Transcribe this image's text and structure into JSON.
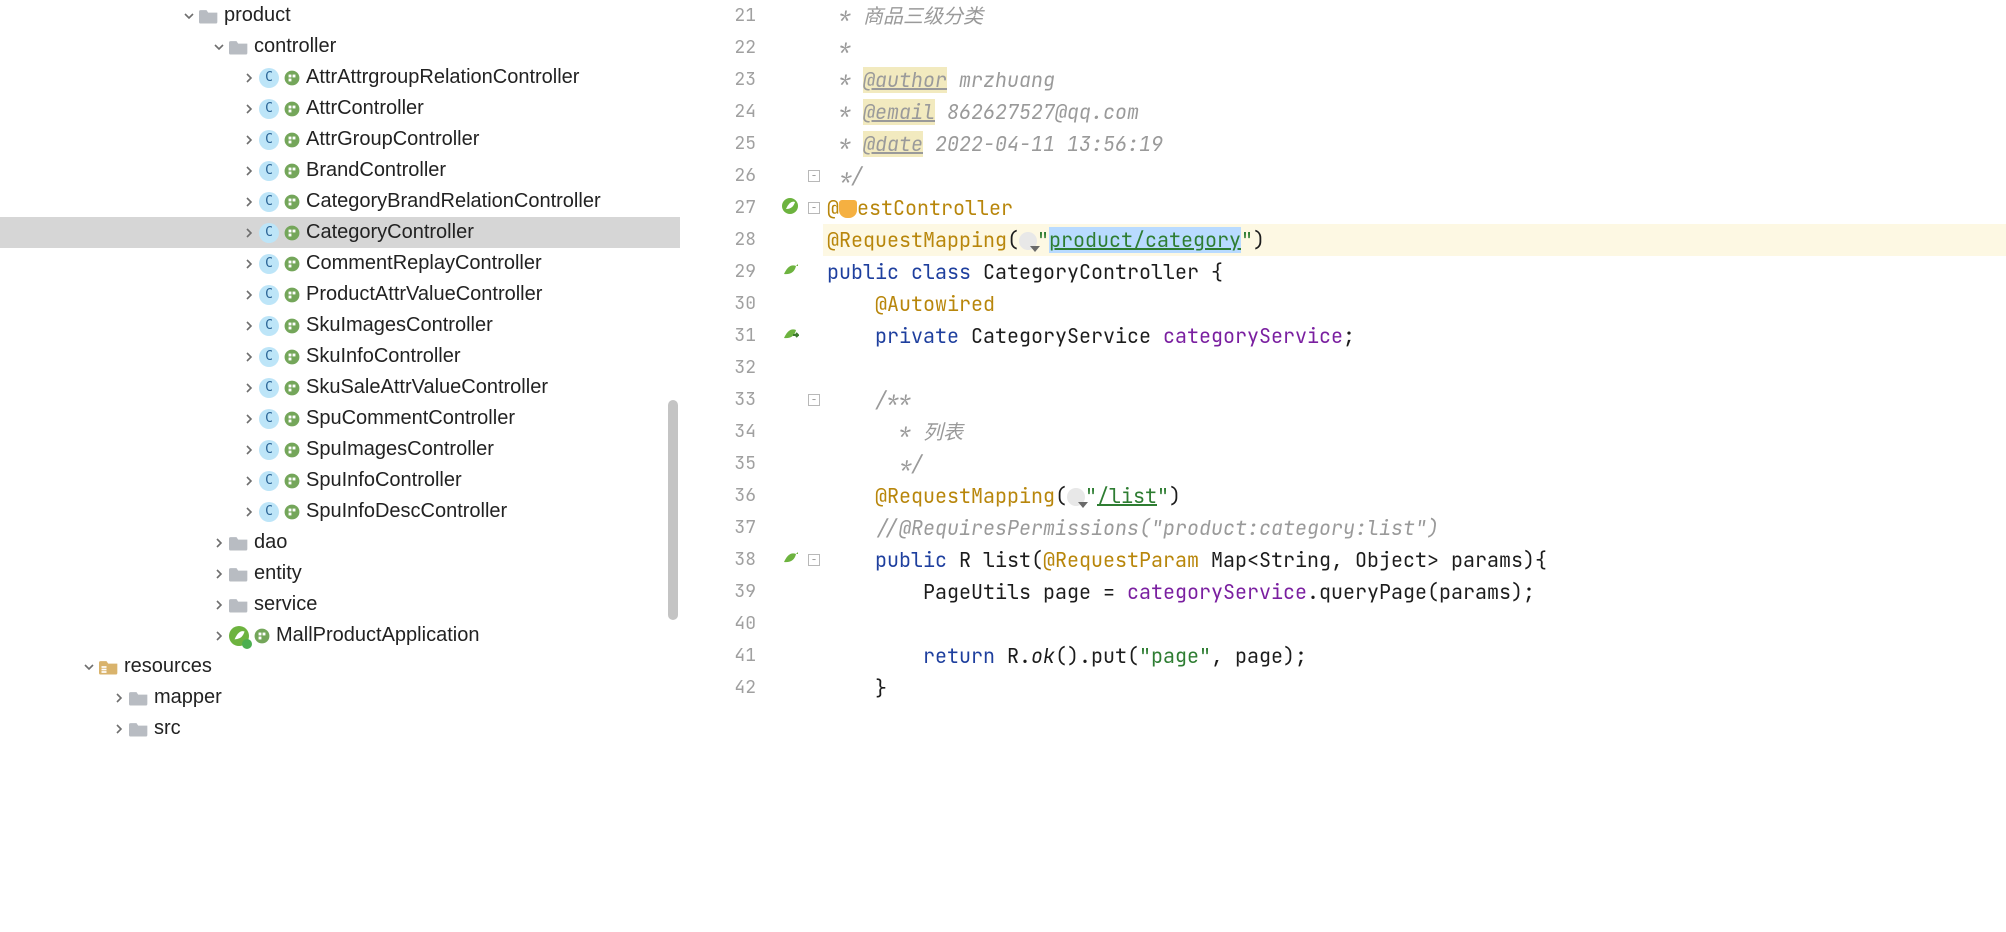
{
  "tree": {
    "root_product": "product",
    "controller_folder": "controller",
    "controllers": [
      "AttrAttrgroupRelationController",
      "AttrController",
      "AttrGroupController",
      "BrandController",
      "CategoryBrandRelationController",
      "CategoryController",
      "CommentReplayController",
      "ProductAttrValueController",
      "SkuImagesController",
      "SkuInfoController",
      "SkuSaleAttrValueController",
      "SpuCommentController",
      "SpuImagesController",
      "SpuInfoController",
      "SpuInfoDescController"
    ],
    "selected_controller_index": 5,
    "dao_folder": "dao",
    "entity_folder": "entity",
    "service_folder": "service",
    "main_class": "MallProductApplication",
    "resources_folder": "resources",
    "mapper_folder": "mapper",
    "src_folder": "src"
  },
  "editor": {
    "first_line_no": 21,
    "lines": [
      {
        "no": 21,
        "kind": "doccomment",
        "text": " * 商品三级分类"
      },
      {
        "no": 22,
        "kind": "doccomment",
        "text": " *"
      },
      {
        "no": 23,
        "kind": "doctag",
        "tag": "@author",
        "value": " mrzhuang"
      },
      {
        "no": 24,
        "kind": "doctag",
        "tag": "@email",
        "value": " 862627527@qq.com"
      },
      {
        "no": 25,
        "kind": "doctag",
        "tag": "@date",
        "value": " 2022-04-11 13:56:19"
      },
      {
        "no": 26,
        "kind": "doccomment",
        "text": " */"
      },
      {
        "no": 27,
        "kind": "rest_controller"
      },
      {
        "no": 28,
        "kind": "req_mapping_class",
        "value": "product/category",
        "highlight": true
      },
      {
        "no": 29,
        "kind": "class_decl",
        "class_name": "CategoryController"
      },
      {
        "no": 30,
        "kind": "autowired"
      },
      {
        "no": 31,
        "kind": "field_decl",
        "type": "CategoryService",
        "name": "categoryService"
      },
      {
        "no": 32,
        "kind": "blank"
      },
      {
        "no": 33,
        "kind": "doccomment",
        "text": "    /**"
      },
      {
        "no": 34,
        "kind": "doccomment",
        "text": "      * 列表"
      },
      {
        "no": 35,
        "kind": "doccomment",
        "text": "      */"
      },
      {
        "no": 36,
        "kind": "req_mapping_method",
        "value": "/list"
      },
      {
        "no": 37,
        "kind": "line_comment",
        "text": "    //@RequiresPermissions(\"product:category:list\")"
      },
      {
        "no": 38,
        "kind": "method_decl"
      },
      {
        "no": 39,
        "kind": "body1"
      },
      {
        "no": 40,
        "kind": "blank"
      },
      {
        "no": 41,
        "kind": "return_stmt"
      },
      {
        "no": 42,
        "kind": "close_brace"
      }
    ],
    "req_mapping_anno": "@RequestMapping",
    "rest_controller_text": "estController",
    "autowired_anno": "@Autowired",
    "request_param_anno": "@RequestParam",
    "class_kw": "class",
    "public_kw": "public",
    "private_kw": "private",
    "return_kw": "return",
    "method_sig_before": " R list(",
    "method_sig_types": " Map<String, Object> params){",
    "body1_text": "        PageUtils page = ",
    "body1_call": "categoryService",
    "body1_after": ".queryPage(params);",
    "return_text_before": "        return R.",
    "return_ok": "ok",
    "return_text_after": "().put(",
    "return_pagekey": "\"page\"",
    "return_tail": ", page);",
    "close_brace_text": "    }"
  }
}
